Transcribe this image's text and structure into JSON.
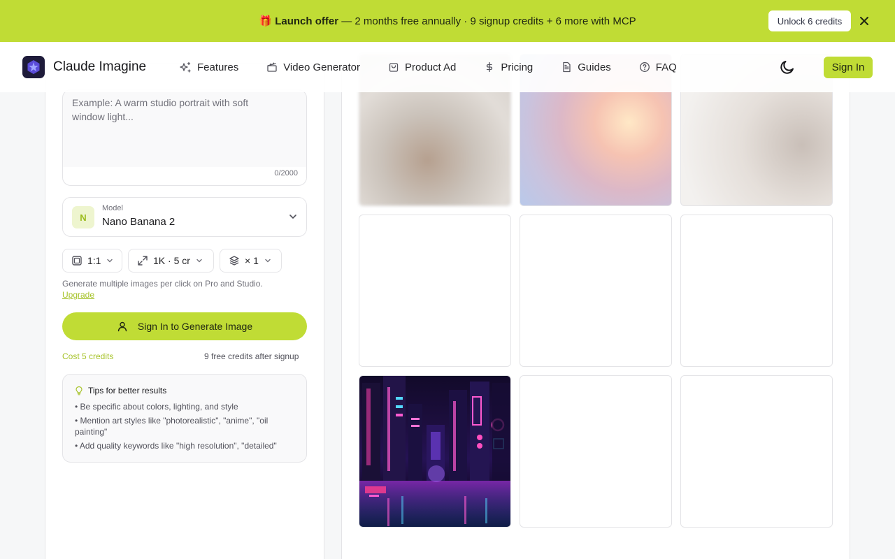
{
  "banner": {
    "emoji": "🎁",
    "bold": "Launch offer",
    "text": " — 2 months free annually · 9 signup credits + 6 more with MCP",
    "button": "Unlock 6 credits"
  },
  "header": {
    "brand": "Claude Imagine",
    "nav": [
      {
        "label": "Features",
        "icon": "sparkles-icon"
      },
      {
        "label": "Video Generator",
        "icon": "clapperboard-icon"
      },
      {
        "label": "Product Ad",
        "icon": "shopping-bag-icon"
      },
      {
        "label": "Pricing",
        "icon": "dollar-icon"
      },
      {
        "label": "Guides",
        "icon": "document-icon"
      },
      {
        "label": "FAQ",
        "icon": "help-circle-icon"
      }
    ],
    "sign_in": "Sign In"
  },
  "generator": {
    "prompt_placeholder": "Example: A warm studio portrait with soft window light...",
    "char_count": "0/2000",
    "model_label": "Model",
    "model_badge": "N",
    "model_name": "Nano Banana 2",
    "aspect": "1:1",
    "quality": "1K · 5 cr",
    "count": "× 1",
    "hint": "Generate multiple images per click on Pro and Studio.",
    "upgrade": "Upgrade",
    "generate_button": "Sign In to Generate Image",
    "cost": "Cost 5 credits",
    "free_credits": "9 free credits after signup"
  },
  "tips": {
    "title": "Tips for better results",
    "items": [
      "• Be specific about colors, lighting, and style",
      "• Mention art styles like \"photorealistic\", \"anime\", \"oil painting\"",
      "• Add quality keywords like \"high resolution\", \"detailed\""
    ]
  },
  "colors": {
    "accent": "#c0dc35",
    "accent_text": "#a7c32a"
  }
}
